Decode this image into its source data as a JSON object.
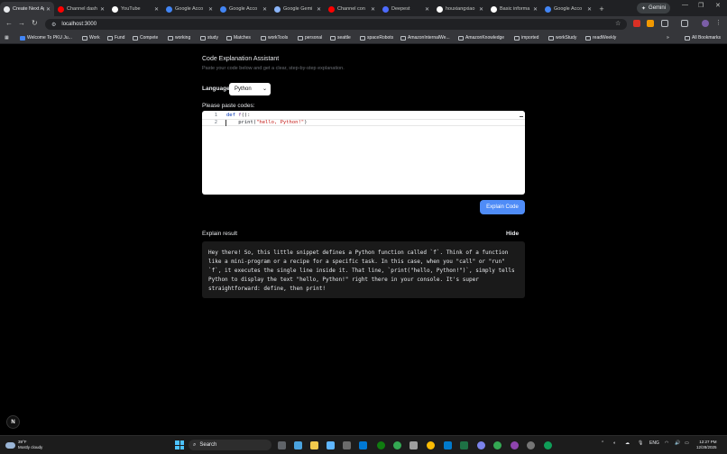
{
  "browser": {
    "tabs": [
      {
        "title": "Create Next App",
        "active": true,
        "color": "#e8eaed"
      },
      {
        "title": "Channel dash",
        "color": "#ff0000"
      },
      {
        "title": "YouTube",
        "color": "#ffffff"
      },
      {
        "title": "Google Acco",
        "color": "#4285f4"
      },
      {
        "title": "Google Acco",
        "color": "#4285f4"
      },
      {
        "title": "Google Gemi",
        "color": "#8ab4f8"
      },
      {
        "title": "Channel con",
        "color": "#ff0000"
      },
      {
        "title": "Deepest",
        "color": "#4d6bfe"
      },
      {
        "title": "houxiangxiao",
        "color": "#ffffff"
      },
      {
        "title": "Basic informa",
        "color": "#ffffff"
      },
      {
        "title": "Google Acco",
        "color": "#4285f4"
      }
    ],
    "new_tab": "+",
    "gemini_label": "Gemini",
    "url": "localhost:3000",
    "bookmarks": [
      "Welcome To PKU Ju...",
      "Work",
      "Fund",
      "Compete",
      "working",
      "study",
      "Matches",
      "workTools",
      "personal",
      "seattle",
      "spaceRobots",
      "AmazonInternalWe...",
      "AmazonKnowledge",
      "imported",
      "workStudy",
      "readWeekly"
    ],
    "more_bookmarks": "»",
    "all_bookmarks": "All Bookmarks"
  },
  "app": {
    "title": "Code Explanation Assistant",
    "subtitle": "Paste your code below and get a clear, step-by-step explanation.",
    "language_label": "Language",
    "language_value": "Python",
    "paste_label": "Please paste codes:",
    "code_lines": [
      {
        "num": "1",
        "kw": "def ",
        "fn": "f",
        "rest": "():"
      },
      {
        "num": "2",
        "indent": "    ",
        "call": "print(",
        "str": "\"hello, Python!\"",
        "close": ")"
      }
    ],
    "explain_button": "Explain Code",
    "result_label": "Explain result",
    "hide_button": "Hide",
    "result_text": "Hey there! So, this little snippet defines a Python function called `f`. Think of a function like a mini-program or a recipe for a specific task. In this case, when you \"call\" or \"run\" `f`, it executes the single line inside it. That line, `print(\"hello, Python!\")`, simply tells Python to display the text \"hello, Python!\" right there in your console. It's super straightforward: define, then print!",
    "badge": "N"
  },
  "taskbar": {
    "temperature": "39°F",
    "weather": "Mostly cloudy",
    "search_placeholder": "Search",
    "lang": "ENG",
    "time": "12:27 PM",
    "date": "12/28/2025"
  }
}
